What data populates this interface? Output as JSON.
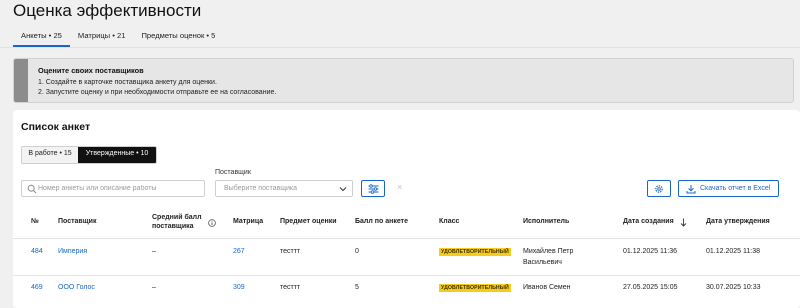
{
  "page": {
    "title": "Оценка эффективности"
  },
  "tabs": [
    {
      "label": "Анкеты • 25",
      "active": true
    },
    {
      "label": "Матрицы • 21",
      "active": false
    },
    {
      "label": "Предметы оценок • 5",
      "active": false
    }
  ],
  "notice": {
    "title": "Оцените своих поставщиков",
    "line1": "1. Создайте в карточке поставщика анкету для оценки.",
    "line2": "2. Запустите оценку и при необходимости отправьте ее на согласование."
  },
  "list": {
    "title": "Список анкет",
    "segments": [
      {
        "label": "В работе • 15",
        "active": false
      },
      {
        "label": "Утвержденные • 10",
        "active": true
      }
    ]
  },
  "filters": {
    "search_placeholder": "Номер анкеты или описание работы",
    "supplier_label": "Поставщик",
    "supplier_placeholder": "Выберите поставщика",
    "clear_symbol": "×",
    "export_label": "Скачать отчет в Excel"
  },
  "table": {
    "headers": {
      "num": "№",
      "supplier": "Поставщик",
      "avg_line1": "Средний балл",
      "avg_line2": "поставщика",
      "matrix": "Матрица",
      "subject": "Предмет оценки",
      "score": "Балл по анкете",
      "class": "Класс",
      "executor": "Исполнитель",
      "created": "Дата создания",
      "approved": "Дата утверждения"
    },
    "rows": [
      {
        "num": "484",
        "supplier": "Империя",
        "avg": "–",
        "matrix": "267",
        "subject": "тесттт",
        "score": "0",
        "class": "УДОВЛЕТВОРИТЕЛЬНЫЙ",
        "executor_line1": "Михайлев Петр",
        "executor_line2": "Васильевич",
        "created": "01.12.2025 11:36",
        "approved": "01.12.2025 11:38"
      },
      {
        "num": "469",
        "supplier": "ООО Голос",
        "avg": "–",
        "matrix": "309",
        "subject": "тесттт",
        "score": "5",
        "class": "УДОВЛЕТВОРИТЕЛЬНЫЙ",
        "executor_line1": "Иванов Семен",
        "executor_line2": "",
        "created": "27.05.2025 15:05",
        "approved": "30.07.2025 10:33"
      }
    ]
  },
  "colors": {
    "accent": "#1a66c9",
    "badge": "#f6cc1c",
    "notice_bar": "#8c8c8c",
    "page_bg": "#f0f0f0"
  },
  "icons": [
    "search-icon",
    "chevron-down-icon",
    "filter-settings-icon",
    "close-icon",
    "gear-icon",
    "download-icon",
    "info-icon",
    "sort-arrow-down-icon"
  ]
}
